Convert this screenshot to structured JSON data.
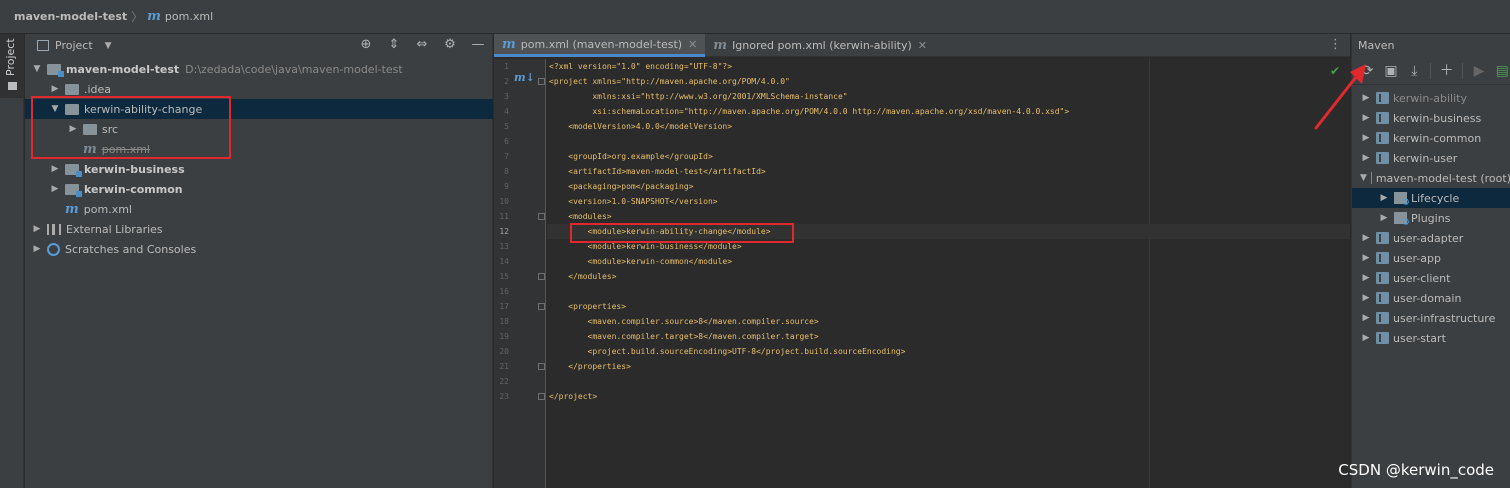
{
  "navbar": {
    "project": "maven-model-test",
    "file": "pom.xml"
  },
  "stripe": {
    "label": "Project"
  },
  "project_panel": {
    "title": "Project",
    "tree": [
      {
        "label": "maven-model-test",
        "path": "D:\\zedada\\code\\java\\maven-model-test"
      },
      {
        "label": ".idea"
      },
      {
        "label": "kerwin-ability-change"
      },
      {
        "label": "src"
      },
      {
        "label": "pom.xml"
      },
      {
        "label": "kerwin-business"
      },
      {
        "label": "kerwin-common"
      },
      {
        "label": "pom.xml"
      },
      {
        "label": "External Libraries"
      },
      {
        "label": "Scratches and Consoles"
      }
    ]
  },
  "editor": {
    "tabs": [
      {
        "label": "pom.xml (maven-model-test)"
      },
      {
        "label": "Ignored pom.xml (kerwin-ability)"
      }
    ],
    "lines": [
      {
        "n": "1",
        "text": "<?xml version=\"1.0\" encoding=\"UTF-8\"?>"
      },
      {
        "n": "2",
        "text": "<project xmlns=\"http://maven.apache.org/POM/4.0.0\""
      },
      {
        "n": "3",
        "text": "         xmlns:xsi=\"http://www.w3.org/2001/XMLSchema-instance\""
      },
      {
        "n": "4",
        "text": "         xsi:schemaLocation=\"http://maven.apache.org/POM/4.0.0 http://maven.apache.org/xsd/maven-4.0.0.xsd\">"
      },
      {
        "n": "5",
        "text": "    <modelVersion>4.0.0</modelVersion>"
      },
      {
        "n": "6",
        "text": ""
      },
      {
        "n": "7",
        "text": "    <groupId>org.example</groupId>"
      },
      {
        "n": "8",
        "text": "    <artifactId>maven-model-test</artifactId>"
      },
      {
        "n": "9",
        "text": "    <packaging>pom</packaging>"
      },
      {
        "n": "10",
        "text": "    <version>1.0-SNAPSHOT</version>"
      },
      {
        "n": "11",
        "text": "    <modules>"
      },
      {
        "n": "12",
        "text": "        <module>kerwin-ability-change</module>"
      },
      {
        "n": "13",
        "text": "        <module>kerwin-business</module>"
      },
      {
        "n": "14",
        "text": "        <module>kerwin-common</module>"
      },
      {
        "n": "15",
        "text": "    </modules>"
      },
      {
        "n": "16",
        "text": ""
      },
      {
        "n": "17",
        "text": "    <properties>"
      },
      {
        "n": "18",
        "text": "        <maven.compiler.source>8</maven.compiler.source>"
      },
      {
        "n": "19",
        "text": "        <maven.compiler.target>8</maven.compiler.target>"
      },
      {
        "n": "20",
        "text": "        <project.build.sourceEncoding>UTF-8</project.build.sourceEncoding>"
      },
      {
        "n": "21",
        "text": "    </properties>"
      },
      {
        "n": "22",
        "text": ""
      },
      {
        "n": "23",
        "text": "</project>"
      }
    ]
  },
  "maven_panel": {
    "title": "Maven",
    "items": [
      {
        "label": "kerwin-ability"
      },
      {
        "label": "kerwin-business"
      },
      {
        "label": "kerwin-common"
      },
      {
        "label": "kerwin-user"
      },
      {
        "label": "maven-model-test (root)"
      },
      {
        "label": "Lifecycle"
      },
      {
        "label": "Plugins"
      },
      {
        "label": "user-adapter"
      },
      {
        "label": "user-app"
      },
      {
        "label": "user-client"
      },
      {
        "label": "user-domain"
      },
      {
        "label": "user-infrastructure"
      },
      {
        "label": "user-start"
      }
    ]
  },
  "watermark": "CSDN @kerwin_code",
  "colors": {
    "highlight_box": "#e0282d",
    "accent": "#4a88c7",
    "selection": "#0d293e"
  }
}
